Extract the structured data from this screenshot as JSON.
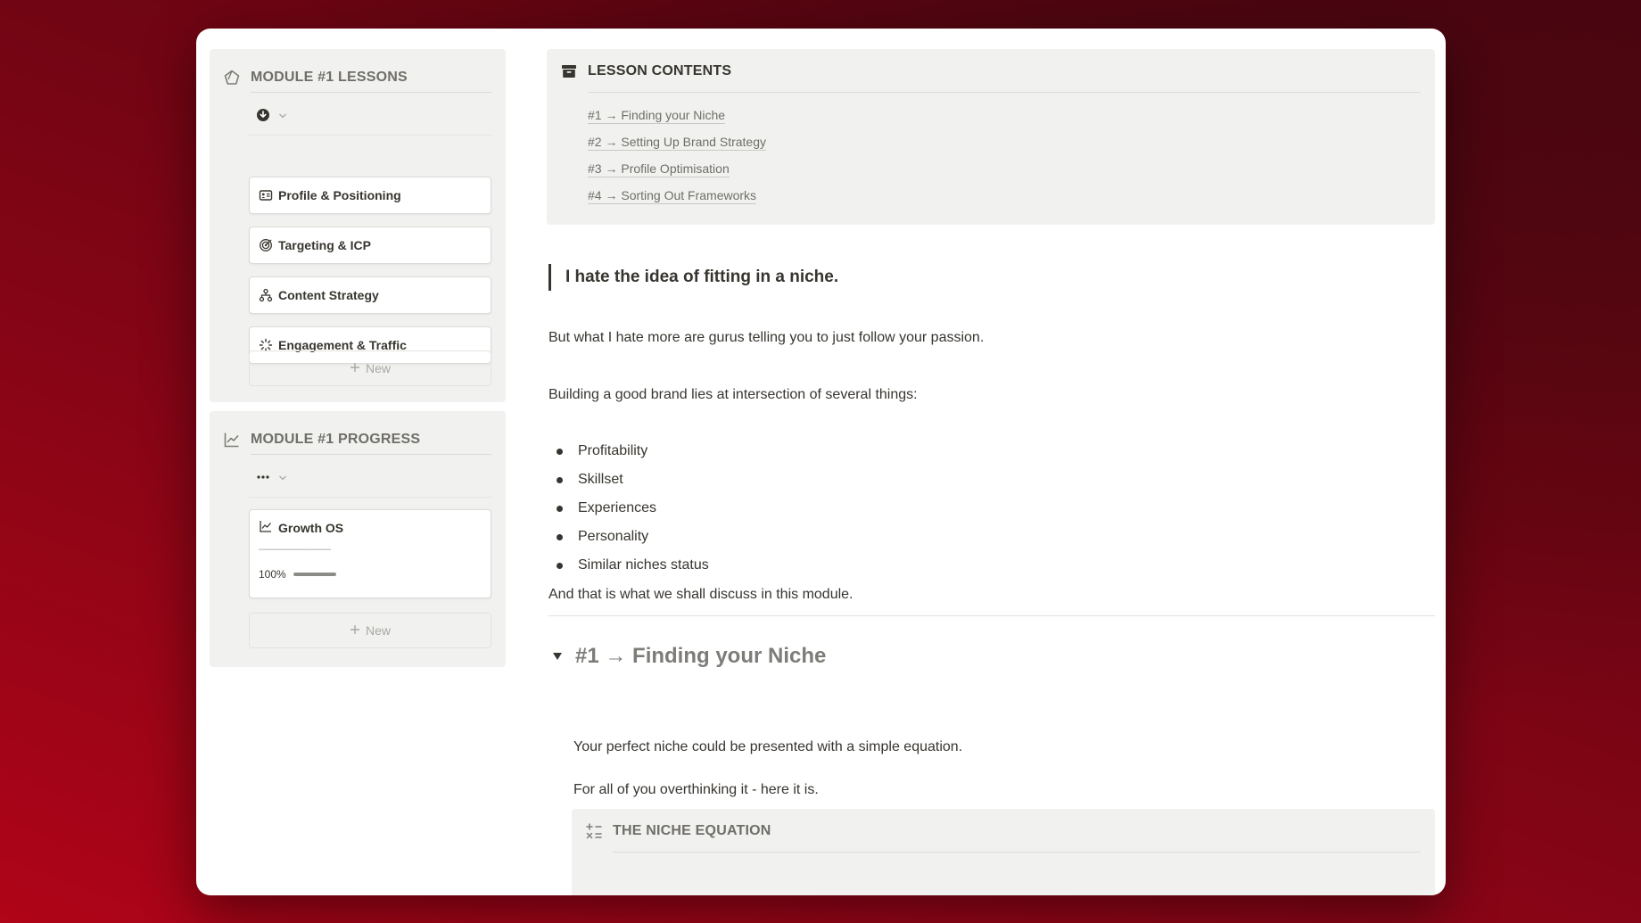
{
  "sidebar": {
    "lessons": {
      "title": "MODULE #1 LESSONS",
      "icon": "pentagon-icon",
      "view_icon": "download-circle-icon",
      "items": [
        {
          "label": "Profile & Positioning",
          "icon": "id-card-icon"
        },
        {
          "label": "Targeting & ICP",
          "icon": "target-icon"
        },
        {
          "label": "Content Strategy",
          "icon": "hierarchy-icon"
        },
        {
          "label": "Engagement & Traffic",
          "icon": "click-sparkle-icon"
        }
      ],
      "new_label": "New"
    },
    "progress": {
      "title": "MODULE #1 PROGRESS",
      "icon": "chart-line-icon",
      "view_icon": "more-dots-icon",
      "card": {
        "title": "Growth OS",
        "dash": "————————",
        "percent_label": "100%",
        "percent": 1.0
      },
      "new_label": "New"
    }
  },
  "toc": {
    "title": "LESSON CONTENTS",
    "icon": "archive-box-icon",
    "items": [
      "#1 → Finding your Niche",
      "#2 → Setting Up Brand Strategy",
      "#3 → Profile Optimisation",
      "#4 → Sorting Out Frameworks"
    ]
  },
  "content": {
    "quote": "I hate the idea of fitting in a niche.",
    "p1": "But what I hate more are gurus telling you to just follow your passion.",
    "p2": "Building a good brand lies at intersection of several things:",
    "bullets": [
      "Profitability",
      "Skillset",
      "Experiences",
      "Personality",
      "Similar niches status"
    ],
    "p3": "And that is what we shall discuss in this module.",
    "toggle_title": "#1 → Finding your Niche",
    "toggle_p1": "Your perfect niche could be presented with a simple equation.",
    "toggle_p2": "For all of you overthinking it - here it is.",
    "equation_title": "THE NICHE EQUATION",
    "equation_icon": "math-operators-icon"
  },
  "colors": {
    "accent_bg": "#f1f1ef",
    "text": "#37352f",
    "muted": "#6f6e69"
  }
}
